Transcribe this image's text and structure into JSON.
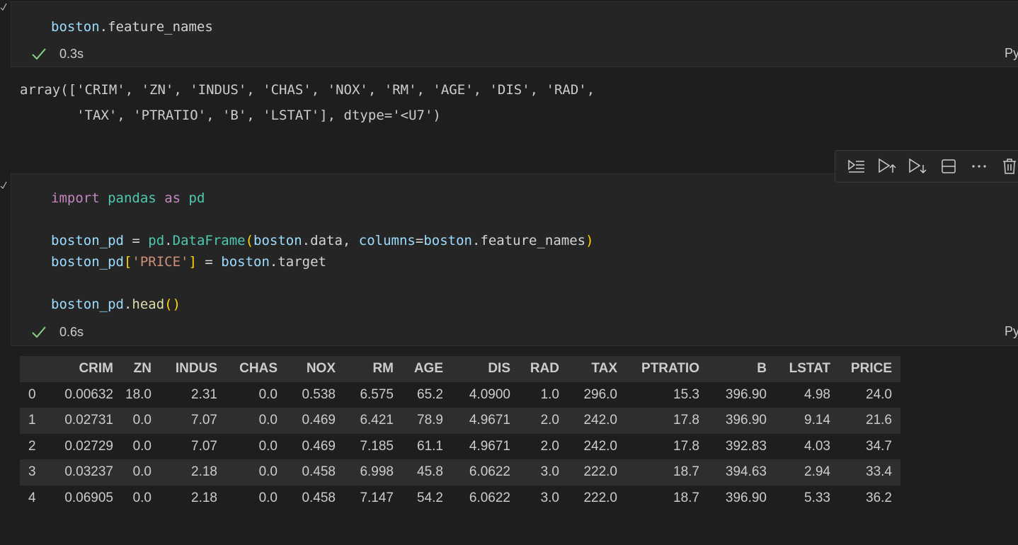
{
  "cell1": {
    "code": {
      "obj": "boston",
      "dot": ".",
      "attr": "feature_names"
    },
    "status_time": "0.3s",
    "language": "Python"
  },
  "output1": {
    "line1": "array(['CRIM', 'ZN', 'INDUS', 'CHAS', 'NOX', 'RM', 'AGE', 'DIS', 'RAD',",
    "line2": "       'TAX', 'PTRATIO', 'B', 'LSTAT'], dtype='<U7')"
  },
  "cell2": {
    "line1": {
      "kw_import": "import",
      "mod": "pandas",
      "kw_as": "as",
      "alias": "pd"
    },
    "line2": {
      "var": "boston_pd",
      "eq": " = ",
      "mod": "pd",
      "dot": ".",
      "cls": "DataFrame",
      "lparen": "(",
      "arg1_obj": "boston",
      "dot2": ".",
      "arg1_attr": "data",
      "comma": ", ",
      "kwarg": "columns",
      "eq2": "=",
      "arg2_obj": "boston",
      "dot3": ".",
      "arg2_attr": "feature_names",
      "rparen": ")"
    },
    "line3": {
      "var": "boston_pd",
      "lbr": "[",
      "key": "'PRICE'",
      "rbr": "]",
      "eq": " = ",
      "obj": "boston",
      "dot": ".",
      "attr": "target"
    },
    "line4": {
      "var": "boston_pd",
      "dot": ".",
      "fn": "head",
      "parens": "()"
    },
    "status_time": "0.6s",
    "language": "Python"
  },
  "toolbar": {
    "icons": [
      "run-by-line-icon",
      "execute-above-icon",
      "execute-below-icon",
      "split-cell-icon",
      "more-icon",
      "delete-icon"
    ]
  },
  "table": {
    "columns": [
      "CRIM",
      "ZN",
      "INDUS",
      "CHAS",
      "NOX",
      "RM",
      "AGE",
      "DIS",
      "RAD",
      "TAX",
      "PTRATIO",
      "B",
      "LSTAT",
      "PRICE"
    ],
    "rows": [
      {
        "index": "0",
        "values": [
          "0.00632",
          "18.0",
          "2.31",
          "0.0",
          "0.538",
          "6.575",
          "65.2",
          "4.0900",
          "1.0",
          "296.0",
          "15.3",
          "396.90",
          "4.98",
          "24.0"
        ]
      },
      {
        "index": "1",
        "values": [
          "0.02731",
          "0.0",
          "7.07",
          "0.0",
          "0.469",
          "6.421",
          "78.9",
          "4.9671",
          "2.0",
          "242.0",
          "17.8",
          "396.90",
          "9.14",
          "21.6"
        ]
      },
      {
        "index": "2",
        "values": [
          "0.02729",
          "0.0",
          "7.07",
          "0.0",
          "0.469",
          "7.185",
          "61.1",
          "4.9671",
          "2.0",
          "242.0",
          "17.8",
          "392.83",
          "4.03",
          "34.7"
        ]
      },
      {
        "index": "3",
        "values": [
          "0.03237",
          "0.0",
          "2.18",
          "0.0",
          "0.458",
          "6.998",
          "45.8",
          "6.0622",
          "3.0",
          "222.0",
          "18.7",
          "394.63",
          "2.94",
          "33.4"
        ]
      },
      {
        "index": "4",
        "values": [
          "0.06905",
          "0.0",
          "2.18",
          "0.0",
          "0.458",
          "7.147",
          "54.2",
          "6.0622",
          "3.0",
          "222.0",
          "18.7",
          "396.90",
          "5.33",
          "36.2"
        ]
      }
    ]
  },
  "colors": {
    "background": "#1e1e1e",
    "cell_background": "#252526",
    "success_check": "#89d185"
  }
}
